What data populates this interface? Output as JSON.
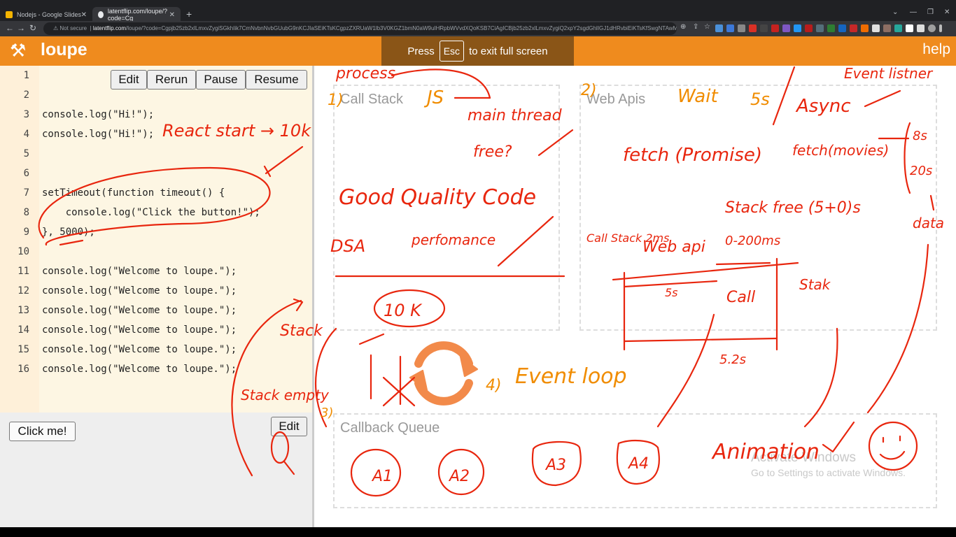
{
  "browser": {
    "tabs": [
      {
        "title": "Nodejs - Google Slides"
      },
      {
        "title": "latentflip.com/loupe/?code=Cg"
      }
    ],
    "security_label": "Not secure",
    "url_host": "latentflip.com",
    "url_rest": "/loupe/?code=Cgpjb25zb2xlLmxvZygiSGkhIik7CmNvbnNvbGUubG9nKCJIaSEiKTsKCgpzZXRUaW1lb3V0KGZ1bmN0aW9uIHRpbWVvdXQoKSB7CiAgICBjb25zb2xlLmxvZygiQ2xpY2sgdGhlIGJ1dHRvbiEiKTsKfSwgNTAwMCk7Cgpjb25zb2xlLmxvZygi..."
  },
  "header": {
    "logo": "loupe",
    "banner_press": "Press",
    "banner_key": "Esc",
    "banner_rest": "to exit full screen",
    "help": "help"
  },
  "editor": {
    "buttons": {
      "edit": "Edit",
      "rerun": "Rerun",
      "pause": "Pause",
      "resume": "Resume"
    },
    "lines": [
      {
        "n": "1",
        "code": ""
      },
      {
        "n": "2",
        "code": ""
      },
      {
        "n": "3",
        "code": "console.log(\"Hi!\");"
      },
      {
        "n": "4",
        "code": "console.log(\"Hi!\");"
      },
      {
        "n": "5",
        "code": ""
      },
      {
        "n": "6",
        "code": ""
      },
      {
        "n": "7",
        "code": "setTimeout(function timeout() {"
      },
      {
        "n": "8",
        "code": "    console.log(\"Click the button!\");"
      },
      {
        "n": "9",
        "code": "}, 5000);"
      },
      {
        "n": "10",
        "code": ""
      },
      {
        "n": "11",
        "code": "console.log(\"Welcome to loupe.\");"
      },
      {
        "n": "12",
        "code": "console.log(\"Welcome to loupe.\");"
      },
      {
        "n": "13",
        "code": "console.log(\"Welcome to loupe.\");"
      },
      {
        "n": "14",
        "code": "console.log(\"Welcome to loupe.\");"
      },
      {
        "n": "15",
        "code": "console.log(\"Welcome to loupe.\");"
      },
      {
        "n": "16",
        "code": "console.log(\"Welcome to loupe.\");"
      }
    ]
  },
  "output": {
    "click_me": "Click me!",
    "edit": "Edit"
  },
  "visual": {
    "call_stack": "Call Stack",
    "web_apis": "Web Apis",
    "callback_queue": "Callback Queue",
    "watermark_title": "Activate Windows",
    "watermark_sub": "Go to Settings to activate Windows."
  },
  "annotations": {
    "react": "React start → 10k",
    "process": "process",
    "js": "JS",
    "main_thread": "main thread",
    "free": "free?",
    "good_quality": "Good Quality Code",
    "dsa": "DSA",
    "performance": "perfomance",
    "ok": "10 K",
    "wait": "Wait",
    "five_s": "5s",
    "async": "Async",
    "event_listener": "Event listner",
    "fetch": "fetch (Promise)",
    "fetch_movies": "fetch(movies)",
    "eight_s": "8s",
    "twenty_s": "20s",
    "data": "data",
    "stack_free": "Stack free (5+0)s",
    "callstack_2ms": "Call Stack 2ms",
    "web_api": "Web api",
    "zero_200": "0-200ms",
    "five_s_span": "5s",
    "call": "Call",
    "stak": "Stak",
    "five_2s": "5.2s",
    "event_loop": "Event loop",
    "four": "4)",
    "three": "3)",
    "one": "1)",
    "two": "2)",
    "stack": "Stack",
    "stack_empty": "Stack empty",
    "animation": "Animation",
    "a1": "A1",
    "a2": "A2",
    "a3": "A3",
    "a4": "A4"
  },
  "colors": {
    "brand": "#ef8b1e",
    "ink": "#e8260e",
    "ink_orange": "#f08c00"
  }
}
